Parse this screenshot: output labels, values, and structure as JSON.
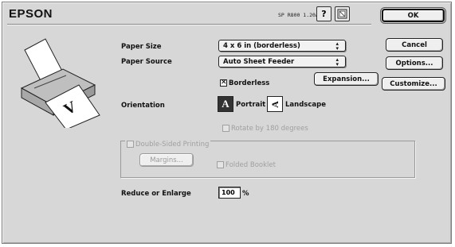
{
  "brand": "EPSON",
  "version": "SP R800 1.20A",
  "help_icon": "?",
  "buttons": {
    "ok": "OK",
    "cancel": "Cancel",
    "options": "Options...",
    "customize": "Customize...",
    "expansion": "Expansion...",
    "margins": "Margins..."
  },
  "paper_size": {
    "label": "Paper Size",
    "value": "4 x 6 in (borderless)"
  },
  "paper_source": {
    "label": "Paper Source",
    "value": "Auto Sheet Feeder"
  },
  "borderless": {
    "label": "Borderless",
    "checked": true
  },
  "orientation": {
    "label": "Orientation",
    "portrait": "Portrait",
    "landscape": "Landscape",
    "selected": "Portrait"
  },
  "rotate": {
    "label": "Rotate by 180 degrees",
    "checked": false
  },
  "double_sided": {
    "label": "Double-Sided Printing",
    "checked": false
  },
  "folded_booklet": {
    "label": "Folded Booklet",
    "checked": false
  },
  "reduce_enlarge": {
    "label": "Reduce or Enlarge",
    "value": "100",
    "unit": "%"
  },
  "icons": [
    "help-icon",
    "page-setup-icon",
    "printer-illustration",
    "portrait-icon",
    "landscape-icon"
  ]
}
